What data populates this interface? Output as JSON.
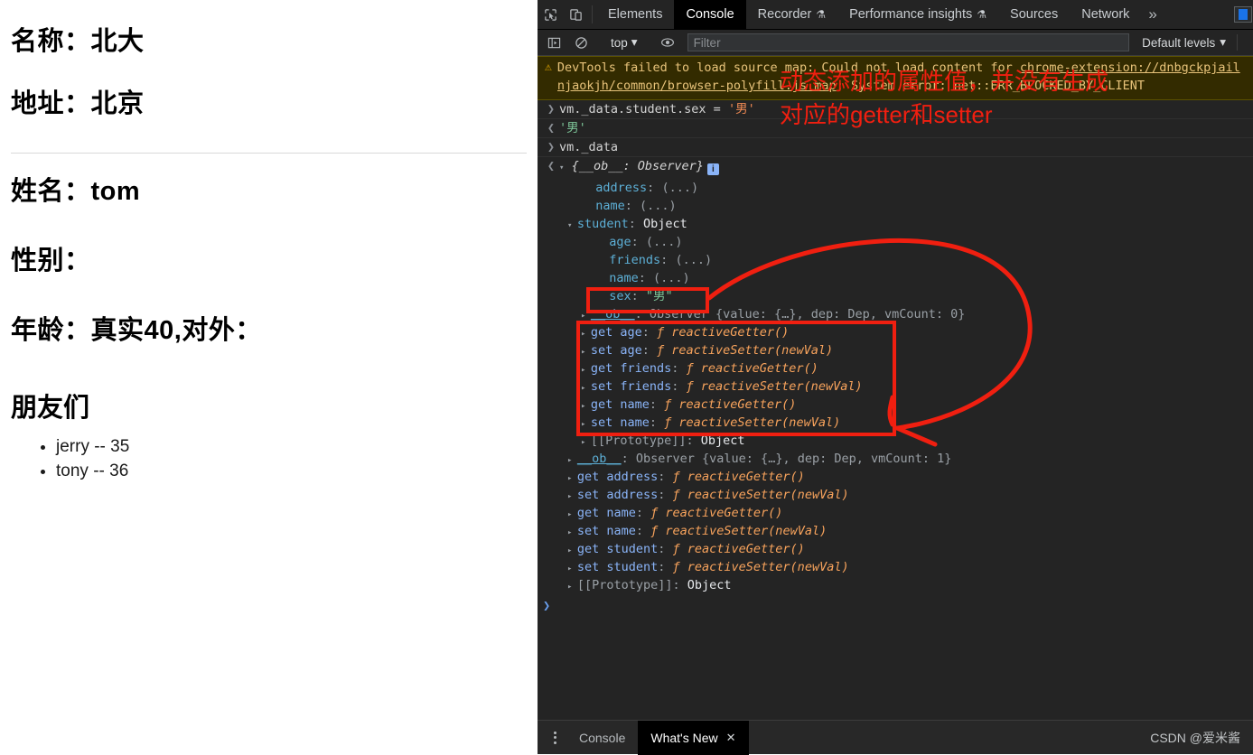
{
  "page": {
    "school": [
      {
        "label": "名称：",
        "value": "北大"
      },
      {
        "label": "地址：",
        "value": "北京"
      }
    ],
    "student": [
      {
        "label": "姓名：",
        "value": "tom"
      },
      {
        "label": "性别：",
        "value": ""
      },
      {
        "label": "年龄：",
        "value": "真实40,对外："
      }
    ],
    "friends_title": "朋友们",
    "friends": [
      "jerry -- 35",
      "tony -- 36"
    ]
  },
  "devtools": {
    "tabs": [
      {
        "label": "Elements",
        "flask": false,
        "active": false
      },
      {
        "label": "Console",
        "flask": false,
        "active": true
      },
      {
        "label": "Recorder",
        "flask": true,
        "active": false
      },
      {
        "label": "Performance insights",
        "flask": true,
        "active": false
      },
      {
        "label": "Sources",
        "flask": false,
        "active": false
      },
      {
        "label": "Network",
        "flask": false,
        "active": false
      }
    ],
    "more_tabs_label": "»",
    "flask_glyph": "⚗",
    "icons": {
      "inspect": "inspect-element-icon",
      "device": "device-toolbar-icon",
      "sidebar": "console-sidebar-icon",
      "clear": "clear-console-icon",
      "eye": "live-expression-icon"
    },
    "filterbar": {
      "context": "top",
      "context_caret": "▾",
      "filter_placeholder": "Filter",
      "filter_value": "",
      "levels": "Default levels",
      "levels_caret": "▾"
    },
    "warning": {
      "icon": "⚠",
      "line1_pre": "DevTools failed to load source map: Could not load content for ",
      "line1_link": "chrome-extension://dnbgckpjail",
      "line2_link": "njaokjh/common/browser-polyfill.js.map",
      "line2_post": ": System error: net::ERR_BLOCKED_BY_CLIENT"
    },
    "console": {
      "input_prompt": "❯",
      "input_expr_pre": "vm._data.student.sex = ",
      "input_expr_str": "'男'",
      "output_prompt": "❮",
      "output_value": "'男'",
      "input2_prompt": "❯",
      "input2_expr": "vm._data",
      "result_prompt": "❮",
      "root_label": "{__ob__: Observer}",
      "info_badge": "i",
      "tree": [
        {
          "indent": 2,
          "arrow": "",
          "key": "address",
          "sep": ": ",
          "value": "(...)",
          "kind": "prop-collapsed"
        },
        {
          "indent": 2,
          "arrow": "",
          "key": "name",
          "sep": ": ",
          "value": "(...)",
          "kind": "prop-collapsed"
        },
        {
          "indent": 1,
          "arrow": "▾",
          "key": "student",
          "sep": ": ",
          "value": "Object",
          "kind": "prop-object"
        },
        {
          "indent": 3,
          "arrow": "",
          "key": "age",
          "sep": ": ",
          "value": "(...)",
          "kind": "prop-collapsed"
        },
        {
          "indent": 3,
          "arrow": "",
          "key": "friends",
          "sep": ": ",
          "value": "(...)",
          "kind": "prop-collapsed"
        },
        {
          "indent": 3,
          "arrow": "",
          "key": "name",
          "sep": ": ",
          "value": "(...)",
          "kind": "prop-collapsed"
        },
        {
          "indent": 3,
          "arrow": "",
          "key": "sex",
          "sep": ": ",
          "value": "\"男\"",
          "kind": "prop-string",
          "boxed": true
        },
        {
          "indent": 2,
          "arrow": "▸",
          "key": "__ob__",
          "sep": ": ",
          "value": "Observer {value: {…}, dep: Dep, vmCount: 0}",
          "kind": "observer"
        },
        {
          "indent": 2,
          "arrow": "▸",
          "key": "get age",
          "sep": ": ",
          "value": "ƒ reactiveGetter()",
          "kind": "accessor"
        },
        {
          "indent": 2,
          "arrow": "▸",
          "key": "set age",
          "sep": ": ",
          "value": "ƒ reactiveSetter(newVal)",
          "kind": "accessor"
        },
        {
          "indent": 2,
          "arrow": "▸",
          "key": "get friends",
          "sep": ": ",
          "value": "ƒ reactiveGetter()",
          "kind": "accessor"
        },
        {
          "indent": 2,
          "arrow": "▸",
          "key": "set friends",
          "sep": ": ",
          "value": "ƒ reactiveSetter(newVal)",
          "kind": "accessor"
        },
        {
          "indent": 2,
          "arrow": "▸",
          "key": "get name",
          "sep": ": ",
          "value": "ƒ reactiveGetter()",
          "kind": "accessor"
        },
        {
          "indent": 2,
          "arrow": "▸",
          "key": "set name",
          "sep": ": ",
          "value": "ƒ reactiveSetter(newVal)",
          "kind": "accessor"
        },
        {
          "indent": 2,
          "arrow": "▸",
          "key": "[[Prototype]]",
          "sep": ": ",
          "value": "Object",
          "kind": "proto"
        },
        {
          "indent": 1,
          "arrow": "▸",
          "key": "__ob__",
          "sep": ": ",
          "value": "Observer {value: {…}, dep: Dep, vmCount: 1}",
          "kind": "observer"
        },
        {
          "indent": 1,
          "arrow": "▸",
          "key": "get address",
          "sep": ": ",
          "value": "ƒ reactiveGetter()",
          "kind": "accessor"
        },
        {
          "indent": 1,
          "arrow": "▸",
          "key": "set address",
          "sep": ": ",
          "value": "ƒ reactiveSetter(newVal)",
          "kind": "accessor"
        },
        {
          "indent": 1,
          "arrow": "▸",
          "key": "get name",
          "sep": ": ",
          "value": "ƒ reactiveGetter()",
          "kind": "accessor"
        },
        {
          "indent": 1,
          "arrow": "▸",
          "key": "set name",
          "sep": ": ",
          "value": "ƒ reactiveSetter(newVal)",
          "kind": "accessor"
        },
        {
          "indent": 1,
          "arrow": "▸",
          "key": "get student",
          "sep": ": ",
          "value": "ƒ reactiveGetter()",
          "kind": "accessor"
        },
        {
          "indent": 1,
          "arrow": "▸",
          "key": "set student",
          "sep": ": ",
          "value": "ƒ reactiveSetter(newVal)",
          "kind": "accessor"
        },
        {
          "indent": 1,
          "arrow": "▸",
          "key": "[[Prototype]]",
          "sep": ": ",
          "value": "Object",
          "kind": "proto"
        }
      ],
      "empty_prompt": "❯"
    },
    "annotation": {
      "line1": "动态添加的属性值，并没有生成",
      "line2": "对应的getter和setter",
      "color": "#f01f10"
    },
    "drawer": {
      "tabs": [
        {
          "label": "Console",
          "active": false,
          "closable": false
        },
        {
          "label": "What's New",
          "active": true,
          "closable": true
        }
      ],
      "close_glyph": "✕",
      "watermark": "CSDN @爱米酱"
    }
  }
}
